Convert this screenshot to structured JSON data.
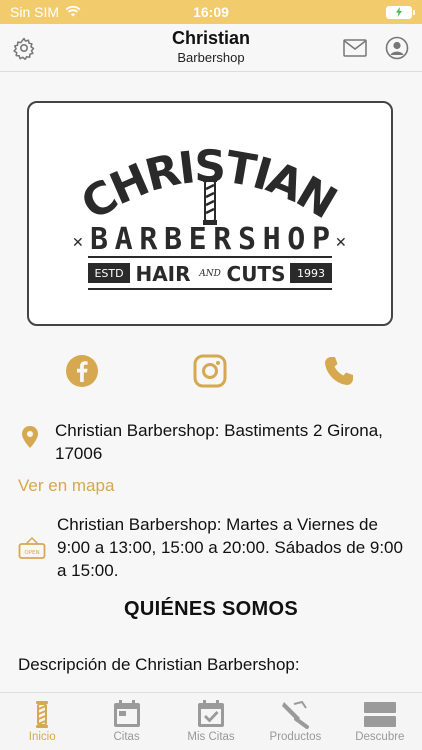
{
  "status_bar": {
    "carrier": "Sin SIM",
    "time": "16:09"
  },
  "header": {
    "title": "Christian",
    "subtitle": "Barbershop"
  },
  "logo": {
    "line1": "CHRISTIAN",
    "line2": "BARBERSHOP",
    "estb": "ESTD",
    "hair": "HAIR",
    "and": "AND",
    "cuts": "CUTS",
    "year": "1993"
  },
  "social": [
    "facebook-icon",
    "instagram-icon",
    "phone-icon"
  ],
  "address": {
    "text": "Christian Barbershop: Bastiments 2 Girona, 17006",
    "map_link": "Ver en mapa"
  },
  "hours": {
    "sign": "OPEN",
    "text": "Christian Barbershop: Martes a Viernes de 9:00 a 13:00, 15:00 a 20:00. Sábados de 9:00 a 15:00."
  },
  "about": {
    "title": "QUIÉNES SOMOS",
    "description": "Descripción de Christian Barbershop:"
  },
  "tabs": [
    {
      "label": "Inicio",
      "icon": "barber-pole-icon",
      "active": true
    },
    {
      "label": "Citas",
      "icon": "calendar-icon",
      "active": false
    },
    {
      "label": "Mis Citas",
      "icon": "calendar-check-icon",
      "active": false
    },
    {
      "label": "Productos",
      "icon": "razor-icon",
      "active": false
    },
    {
      "label": "Descubre",
      "icon": "discover-icon",
      "active": false
    }
  ],
  "colors": {
    "accent": "#d6a84f",
    "status_bar": "#f1cb6c",
    "inactive": "#9a9a9a"
  }
}
